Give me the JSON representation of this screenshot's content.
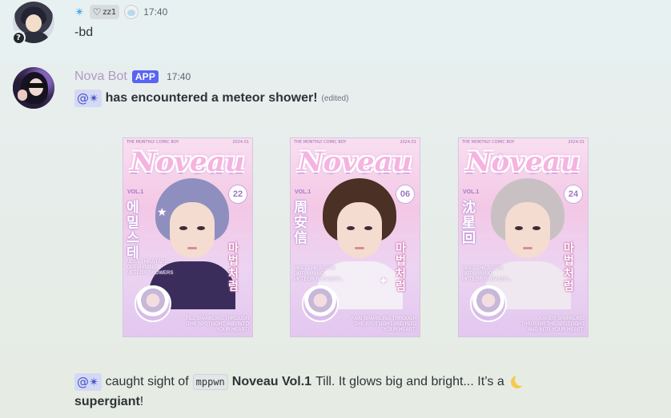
{
  "message1": {
    "username_symbol": "✴",
    "clan_tag": "zz1",
    "clan_heart_symbol": "♡",
    "timestamp": "17:40",
    "text": "-bd",
    "status_symbol": "?"
  },
  "message2": {
    "username": "Nova Bot",
    "app_badge": "APP",
    "timestamp": "17:40",
    "mention": "@✴",
    "text_bold": "has encountered a meteor shower!",
    "edited": "(edited)",
    "cards": [
      {
        "header_left": "THE MONTHLY COMIC BOY",
        "header_right": "2024.01",
        "title": "Noveau",
        "vol": "VOL.1",
        "number": "22",
        "korean_side": "에밀스테",
        "korean_right": "마법처럼",
        "small_left": "MEET THE STARS OUTSHINING METEOR SHOWERS",
        "small_right": "TILL SPARKLING THROUGH THE SPOTLIGHT AND INTO YOUR HEART!",
        "hair_color": "#8e8fbf",
        "outfit_color": "#3a2d5c"
      },
      {
        "header_left": "THE MONTHLY COMIC BOY",
        "header_right": "2024.01",
        "title": "Noveau",
        "vol": "VOL.1",
        "number": "06",
        "korean_side": "周安信",
        "korean_right": "마법처럼",
        "small_left": "MEET THE STARS OUTSHINING METEOR SHOWERS...",
        "small_right": "ANXI SPARKLING THROUGH THE SPOTLIGHT AND INTO YOUR HEART!",
        "hair_color": "#4a3025",
        "outfit_color": "#f4eef6"
      },
      {
        "header_left": "THE MONTHLY COMIC BOY",
        "header_right": "2024.01",
        "title": "Noveau",
        "vol": "VOL.1",
        "number": "24",
        "korean_side": "沈星回",
        "korean_right": "마법처럼",
        "small_left": "MEET THE STARS OUTSHINING METEOR SHOWERS...",
        "small_right": "XAVIER SPARKLING THROUGH THE SPOTLIGHT AND INTO YOUR HEART!",
        "hair_color": "#c9c0c4",
        "outfit_color": "#efe8f0"
      }
    ]
  },
  "message3": {
    "mention": "@✴",
    "text1": "caught sight of",
    "code": "mppwn",
    "bold_title": "Noveau Vol.1",
    "text2": "Till. It glows big and bright... It’s a",
    "bold_end": "supergiant",
    "end_punct": "!"
  },
  "colors": {
    "accent_blue": "#5865f2",
    "bot_name": "#b19ac4",
    "mention_bg": "#d4d9f5",
    "mention_text": "#4752c4",
    "star_user": "#4aa8e8"
  }
}
